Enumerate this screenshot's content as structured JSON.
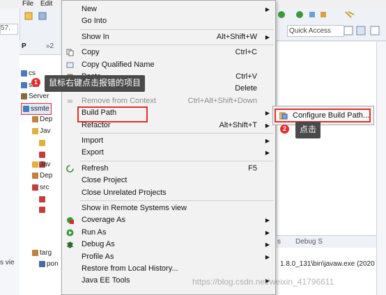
{
  "menubar": {
    "file": "File",
    "edit": "Edit"
  },
  "toolbar": {
    "quick_access": "Quick Access"
  },
  "left_edge": {
    "tab_text": "57.",
    "lower_text": "s vie"
  },
  "explorer": {
    "tab_label": "P",
    "tab_count": "»2",
    "items": [
      {
        "label": "cs",
        "sel": false
      },
      {
        "label": "ssh",
        "sel": false
      },
      {
        "label": "Server",
        "sel": false
      },
      {
        "label": "ssmte",
        "sel": true
      },
      {
        "label": "Dep",
        "sel": false
      },
      {
        "label": "Jav",
        "sel": false
      },
      {
        "label": "",
        "sel": false
      },
      {
        "label": "",
        "sel": false
      },
      {
        "label": "",
        "sel": false
      },
      {
        "label": "Jav",
        "sel": false
      },
      {
        "label": "Dep",
        "sel": false
      },
      {
        "label": "src",
        "sel": false
      },
      {
        "label": "",
        "sel": false
      },
      {
        "label": "",
        "sel": false
      },
      {
        "label": "targ",
        "sel": false
      },
      {
        "label": "pon",
        "sel": false
      }
    ]
  },
  "context_menu": {
    "items": [
      {
        "label": "New",
        "shortcut": "",
        "submenu": true,
        "disabled": false,
        "icon": ""
      },
      {
        "label": "Go Into",
        "shortcut": "",
        "submenu": false,
        "disabled": false,
        "icon": ""
      },
      {
        "sep": true
      },
      {
        "label": "Show In",
        "shortcut": "Alt+Shift+W",
        "submenu": true,
        "disabled": false,
        "icon": ""
      },
      {
        "sep": true
      },
      {
        "label": "Copy",
        "shortcut": "Ctrl+C",
        "submenu": false,
        "disabled": false,
        "icon": "copy-icon"
      },
      {
        "label": "Copy Qualified Name",
        "shortcut": "",
        "submenu": false,
        "disabled": false,
        "icon": "copy-qualified-icon"
      },
      {
        "label": "Paste",
        "shortcut": "Ctrl+V",
        "submenu": false,
        "disabled": false,
        "icon": "paste-icon"
      },
      {
        "label": "Delete",
        "shortcut": "Delete",
        "submenu": false,
        "disabled": false,
        "icon": "delete-icon"
      },
      {
        "label": "Remove from Context",
        "shortcut": "Ctrl+Alt+Shift+Down",
        "submenu": false,
        "disabled": true,
        "icon": "remove-context-icon"
      },
      {
        "label": "Build Path",
        "shortcut": "",
        "submenu": true,
        "disabled": false,
        "icon": ""
      },
      {
        "label": "Refactor",
        "shortcut": "Alt+Shift+T",
        "submenu": true,
        "disabled": false,
        "icon": ""
      },
      {
        "sep": true
      },
      {
        "label": "Import",
        "shortcut": "",
        "submenu": true,
        "disabled": false,
        "icon": ""
      },
      {
        "label": "Export",
        "shortcut": "",
        "submenu": true,
        "disabled": false,
        "icon": ""
      },
      {
        "sep": true
      },
      {
        "label": "Refresh",
        "shortcut": "F5",
        "submenu": false,
        "disabled": false,
        "icon": "refresh-icon"
      },
      {
        "label": "Close Project",
        "shortcut": "",
        "submenu": false,
        "disabled": false,
        "icon": ""
      },
      {
        "label": "Close Unrelated Projects",
        "shortcut": "",
        "submenu": false,
        "disabled": false,
        "icon": ""
      },
      {
        "sep": true
      },
      {
        "label": "Show in Remote Systems view",
        "shortcut": "",
        "submenu": false,
        "disabled": false,
        "icon": ""
      },
      {
        "label": "Coverage As",
        "shortcut": "",
        "submenu": true,
        "disabled": false,
        "icon": "coverage-icon"
      },
      {
        "label": "Run As",
        "shortcut": "",
        "submenu": true,
        "disabled": false,
        "icon": "run-icon"
      },
      {
        "label": "Debug As",
        "shortcut": "",
        "submenu": true,
        "disabled": false,
        "icon": "debug-icon"
      },
      {
        "label": "Profile As",
        "shortcut": "",
        "submenu": true,
        "disabled": false,
        "icon": ""
      },
      {
        "label": "Restore from Local History...",
        "shortcut": "",
        "submenu": false,
        "disabled": false,
        "icon": ""
      },
      {
        "label": "Java EE Tools",
        "shortcut": "",
        "submenu": true,
        "disabled": false,
        "icon": ""
      }
    ]
  },
  "submenu": {
    "configure_label": "Configure Build Path..."
  },
  "callouts": {
    "step1_number": "1",
    "step1_text": "鼠标右键点击报错的项目",
    "step2_number": "2",
    "step2_text": "点击"
  },
  "bottom_panel": {
    "tab_s": "s",
    "tab_debug": "Debug S",
    "console_line": "1.8.0_131\\bin\\javaw.exe (2020"
  },
  "watermark": "https://blog.csdn.net/weixin_41796611",
  "colors": {
    "highlight_border": "#e03030",
    "tooltip_bg": "#4a4a4a",
    "menu_bg": "#f2f2f2"
  }
}
